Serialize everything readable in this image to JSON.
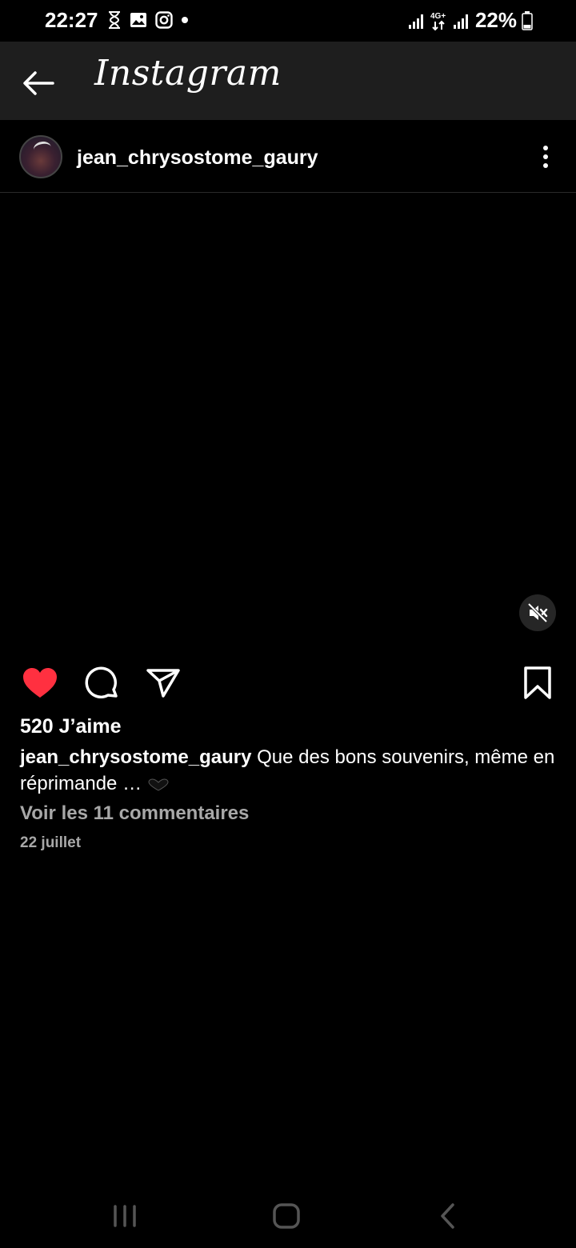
{
  "status_bar": {
    "time": "22:27",
    "battery": "22%",
    "network": "4G+",
    "left_icons": [
      "hourglass-icon",
      "image-icon",
      "instagram-icon",
      "dot-icon"
    ]
  },
  "app_bar": {
    "title": "Instagram"
  },
  "post": {
    "username": "jean_chrysostome_gaury",
    "likes": "520 J’aime",
    "caption_user": "jean_chrysostome_gaury",
    "caption_text": "Que des bons souvenirs, même en réprimande …",
    "view_comments": "Voir les 11 commentaires",
    "date": "22 juillet",
    "liked": true
  },
  "colors": {
    "heart": "#ff3040",
    "app_bar_bg": "#1e1e1e",
    "muted_text": "#a8a8a8"
  }
}
